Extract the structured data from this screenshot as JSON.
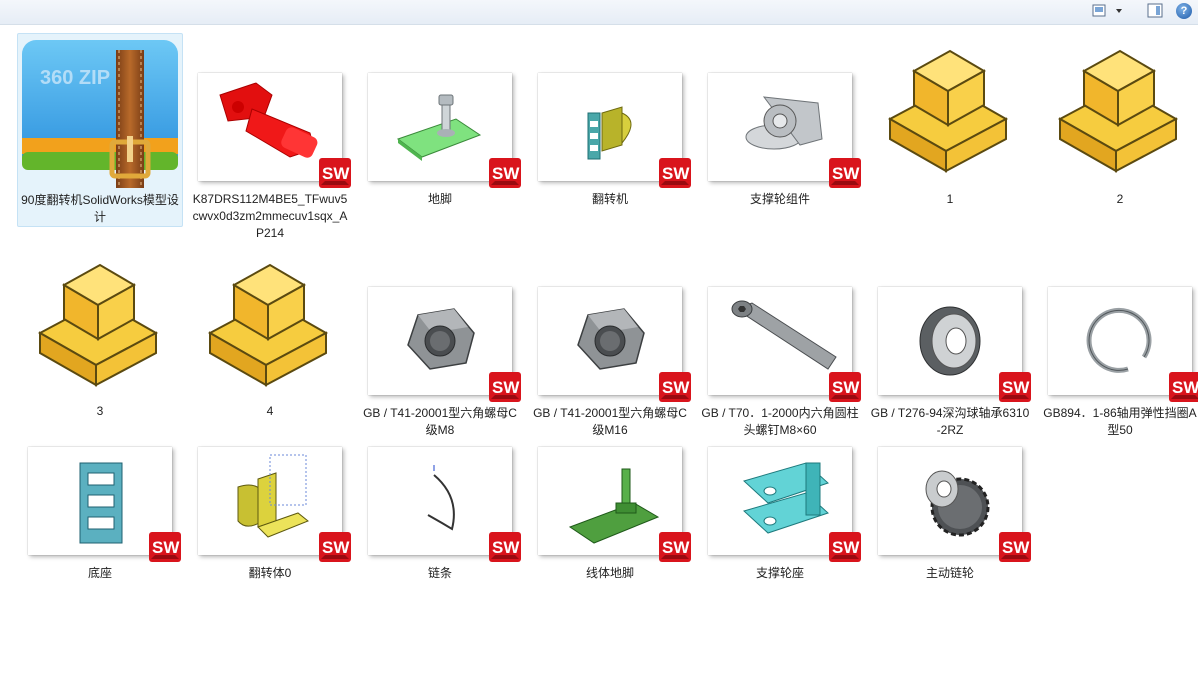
{
  "toolbar": {
    "icons": [
      "view-mode-icon",
      "dropdown-arrow-icon",
      "preview-pane-icon",
      "help-icon"
    ],
    "help_label": "?"
  },
  "items": [
    {
      "name": "90度翻转机SolidWorks模型设计",
      "kind": "zip",
      "icon": "360zip-archive-icon",
      "zip_text": "360 ZIP"
    },
    {
      "name": "K87DRS112M4BE5_TFwuv5cwvx0d3zm2mmecuv1sqx_AP214",
      "kind": "sw",
      "icon": "red-gear-motor-icon"
    },
    {
      "name": "地脚",
      "kind": "sw",
      "icon": "green-foot-base-icon"
    },
    {
      "name": "翻转机",
      "kind": "sw",
      "icon": "tilter-assembly-icon"
    },
    {
      "name": "支撑轮组件",
      "kind": "sw",
      "icon": "support-wheel-assembly-icon"
    },
    {
      "name": "1",
      "kind": "part",
      "icon": "yellow-part-block-icon"
    },
    {
      "name": "2",
      "kind": "part",
      "icon": "yellow-part-block-icon"
    },
    {
      "name": "3",
      "kind": "part",
      "icon": "yellow-part-block-icon"
    },
    {
      "name": "4",
      "kind": "part",
      "icon": "yellow-part-block-icon"
    },
    {
      "name": "GB / T41-20001型六角螺母C级M8",
      "kind": "sw",
      "icon": "hex-nut-icon"
    },
    {
      "name": "GB / T41-20001型六角螺母C级M16",
      "kind": "sw",
      "icon": "hex-nut-icon"
    },
    {
      "name": "GB / T70．1-2000内六角圆柱头螺钉M8×60",
      "kind": "sw",
      "icon": "socket-head-screw-icon"
    },
    {
      "name": "GB / T276-94深沟球轴承6310-2RZ",
      "kind": "sw",
      "icon": "ball-bearing-icon"
    },
    {
      "name": "GB894．1-86轴用弹性挡圈A型50",
      "kind": "sw",
      "icon": "retaining-ring-icon"
    },
    {
      "name": "底座",
      "kind": "sw",
      "icon": "base-frame-icon"
    },
    {
      "name": "翻转体0",
      "kind": "sw",
      "icon": "tilting-body-icon"
    },
    {
      "name": "链条",
      "kind": "sw",
      "icon": "chain-curve-icon"
    },
    {
      "name": "线体地脚",
      "kind": "sw",
      "icon": "line-foot-icon"
    },
    {
      "name": "支撑轮座",
      "kind": "sw",
      "icon": "support-wheel-seat-icon"
    },
    {
      "name": "主动链轮",
      "kind": "sw",
      "icon": "drive-sprocket-icon"
    }
  ],
  "sw_badge": {
    "text": "SW",
    "color": "#d9141c"
  },
  "colors": {
    "part_yellow": "#f7c934",
    "selection": "#e5f3fb",
    "toolbar": "#e9eff6"
  }
}
